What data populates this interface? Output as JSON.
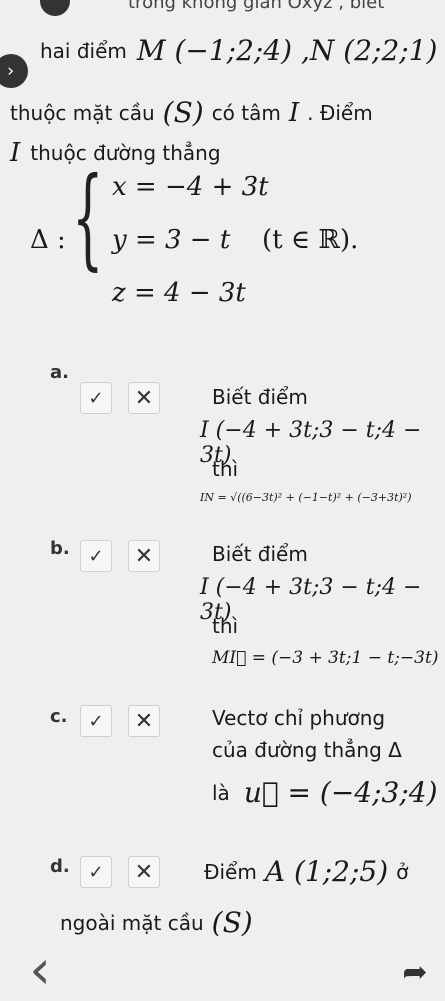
{
  "header": {
    "line0": "trong không gian Oxyz , biết",
    "line1_prefix": "hai điểm",
    "line1_math": "M (−1;2;4) ,N (2;2;1)",
    "line2_a": "thuộc mặt cầu",
    "line2_math": "(S)",
    "line2_b": "có tâm",
    "line2_c": "I",
    "line2_d": ". Điểm",
    "line3_a": "I",
    "line3_b": "thuộc đường thẳng"
  },
  "system": {
    "lhs": "Δ :",
    "eq1": "x = −4 + 3t",
    "eq2": "y = 3 − t",
    "eq3": "z = 4 − 3t",
    "domain": "(t ∈ ℝ)."
  },
  "items": [
    {
      "label": "a.",
      "line1": "Biết điểm",
      "line2": "I (−4 + 3t;3 − t;4 − 3t)",
      "line3": "thì",
      "line4": "IN = √((6−3t)² + (−1−t)² + (−3+3t)²)"
    },
    {
      "label": "b.",
      "line1": "Biết điểm",
      "line2": "I (−4 + 3t;3 − t;4 − 3t)",
      "line3": "thì",
      "line4": "MI⃗ = (−3 + 3t;1 − t;−3t)"
    },
    {
      "label": "c.",
      "line1": "Vectơ chỉ phương",
      "line2": "của đường thẳng Δ",
      "line3": "là",
      "line3_math": "u⃗ = (−4;3;4)"
    },
    {
      "label": "d.",
      "line1": "Điểm",
      "line1_math": "A (1;2;5)",
      "line1_tail": "ở",
      "line2": "ngoài mặt cầu",
      "line2_math": "(S)"
    }
  ],
  "buttons": {
    "check": "✓",
    "cross": "✕"
  },
  "nav": {
    "back": "‹",
    "prev": "‹",
    "next": "➦"
  }
}
